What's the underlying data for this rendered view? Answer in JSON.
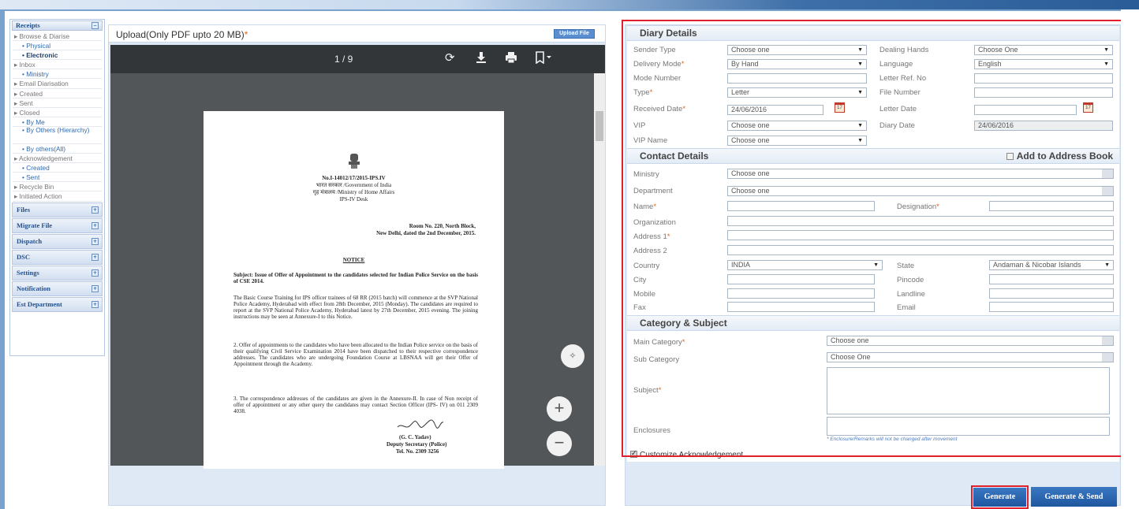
{
  "sidebar": {
    "receipts_header": "Receipts",
    "receipts_items": [
      {
        "label": "Browse & Diarise",
        "level": 0
      },
      {
        "label": "Physical",
        "level": 1
      },
      {
        "label": "Electronic",
        "level": 1,
        "active": true
      },
      {
        "label": "Inbox",
        "level": 0
      },
      {
        "label": "Ministry",
        "level": 1
      },
      {
        "label": "Email Diarisation",
        "level": 0
      },
      {
        "label": "Created",
        "level": 0
      },
      {
        "label": "Sent",
        "level": 0
      },
      {
        "label": "Closed",
        "level": 0
      },
      {
        "label": "By Me",
        "level": 1
      },
      {
        "label": "By Others (Hierarchy)",
        "level": 2
      },
      {
        "label": "By others(All)",
        "level": 1
      },
      {
        "label": "Acknowledgement",
        "level": 0
      },
      {
        "label": "Created",
        "level": 1
      },
      {
        "label": "Sent",
        "level": 1
      },
      {
        "label": "Recycle Bin",
        "level": 0
      },
      {
        "label": "Initiated Action",
        "level": 0
      }
    ],
    "sections": [
      "Files",
      "Migrate File",
      "Dispatch",
      "DSC",
      "Settings",
      "Notification",
      "Est Department"
    ]
  },
  "viewer": {
    "title": "Upload(Only PDF upto 20 MB)",
    "required_mark": "*",
    "upload_button": "Upload File",
    "page_indicator": "1 / 9",
    "zoom_in": "+",
    "zoom_out": "−",
    "document": {
      "ref_no": "No.I-14012/17/2015-IPS.IV",
      "gov_line": "भारत सरकार /Government of India",
      "ministry_line": "गृह मंत्रालय /Ministry of Home Affairs",
      "desk_line": "IPS-IV Desk",
      "address1": "Room No. 220, North Block,",
      "address2": "New Delhi, dated the 2nd December, 2015.",
      "notice_title": "NOTICE",
      "subject": "Subject: Issue of Offer of Appointment to the candidates selected for Indian Police Service on the basis of CSE 2014.",
      "para1": "The Basic Course Training for IPS officer trainees of 68 RR (2015 batch) will commence at the SVP National Police Academy, Hyderabad with effect from 28th December, 2015 (Monday). The candidates are required to report at the SVP National Police Academy, Hyderabad latest by 27th December, 2015 evening. The joining instructions may be seen at Annexure-I to this Notice.",
      "para2": "2.    Offer of appointments to the candidates who have been allocated to the Indian Police service on the basis of their qualifying Civil Service Examination 2014 have been dispatched to their respective correspondence addresses. The candidates who are undergoing Foundation Course at LBSNAA will get their Offer of Appointment through the Academy.",
      "para3": "3.    The correspondence addresses of the candidates are given in the Annexure-II. In case of Non receipt of offer of appointment or any other query the candidates may contact Section Officer (IPS- IV) on 011 2309 4038.",
      "signatory_name": "(G. C. Yadav)",
      "signatory_title": "Deputy Secretary (Police)",
      "signatory_tel": "Tel. No. 2309 3256"
    }
  },
  "form": {
    "diary_details": {
      "title": "Diary Details",
      "sender_type_label": "Sender Type",
      "sender_type_value": "Choose one",
      "dealing_hands_label": "Dealing Hands",
      "dealing_hands_value": "Choose One",
      "delivery_mode_label": "Delivery Mode",
      "delivery_mode_value": "By Hand",
      "language_label": "Language",
      "language_value": "English",
      "mode_number_label": "Mode Number",
      "mode_number_value": "",
      "letter_ref_label": "Letter Ref. No",
      "letter_ref_value": "",
      "type_label": "Type",
      "type_value": "Letter",
      "file_number_label": "File Number",
      "file_number_value": "",
      "received_date_label": "Received Date",
      "received_date_value": "24/06/2016",
      "letter_date_label": "Letter Date",
      "letter_date_value": "",
      "vip_label": "VIP",
      "vip_value": "Choose one",
      "diary_date_label": "Diary Date",
      "diary_date_value": "24/06/2016",
      "vip_name_label": "VIP Name",
      "vip_name_value": "Choose one",
      "calendar_day": "17"
    },
    "contact_details": {
      "title": "Contact Details",
      "add_to_address_book": "Add to Address Book",
      "ministry_label": "Ministry",
      "ministry_value": "Choose one",
      "department_label": "Department",
      "department_value": "Choose one",
      "name_label": "Name",
      "designation_label": "Designation",
      "organization_label": "Organization",
      "address1_label": "Address 1",
      "address2_label": "Address 2",
      "country_label": "Country",
      "country_value": "INDIA",
      "state_label": "State",
      "state_value": "Andaman & Nicobar Islands",
      "city_label": "City",
      "pincode_label": "Pincode",
      "mobile_label": "Mobile",
      "landline_label": "Landline",
      "fax_label": "Fax",
      "email_label": "Email"
    },
    "category_subject": {
      "title": "Category & Subject",
      "main_category_label": "Main Category",
      "main_category_value": "Choose one",
      "sub_category_label": "Sub Category",
      "sub_category_value": "Choose One",
      "subject_label": "Subject",
      "enclosures_label": "Enclosures",
      "enclosure_note": "* Enclosure/Remarks will not be changed after movement"
    },
    "customize_ack_label": "Customize Acknowledgement",
    "required_mark": "*"
  },
  "buttons": {
    "generate": "Generate",
    "generate_send": "Generate & Send"
  },
  "colors": {
    "accent_blue": "#2e6ab1",
    "button_blue": "#1f56a0",
    "highlight_red": "#e0202a",
    "required_orange": "#e2651b"
  }
}
